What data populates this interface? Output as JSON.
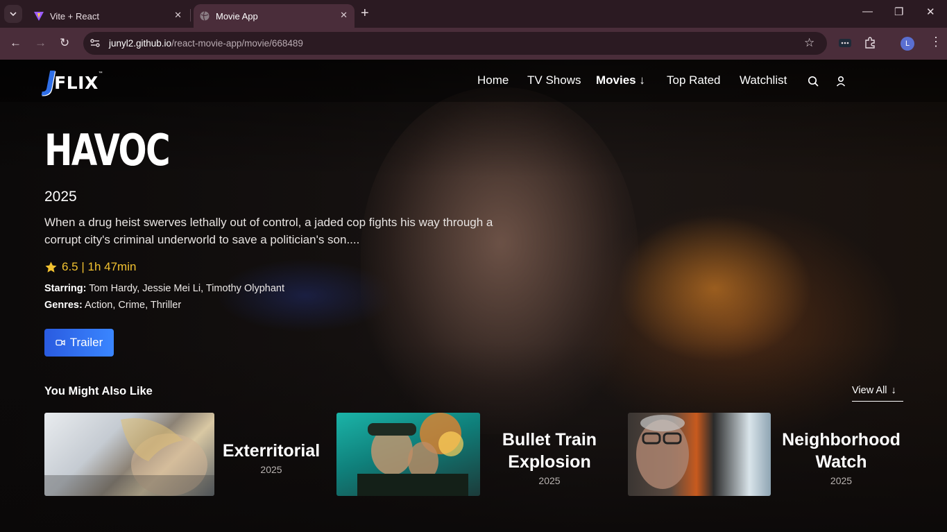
{
  "browser": {
    "tabs": [
      {
        "title": "Vite + React",
        "icon": "vite-icon",
        "active": false
      },
      {
        "title": "Movie App",
        "icon": "globe-icon",
        "active": true
      }
    ],
    "url_host": "junyl2.github.io",
    "url_path": "/react-movie-app/movie/668489",
    "profile_initial": "L"
  },
  "site": {
    "logo_letter": "J",
    "logo_text": "FLIX",
    "logo_tm": "™",
    "nav": [
      {
        "label": "Home"
      },
      {
        "label": "TV Shows"
      },
      {
        "label": "Movies ↓",
        "active": true
      },
      {
        "label": "Top Rated"
      },
      {
        "label": "Watchlist"
      }
    ]
  },
  "movie": {
    "title": "HAVOC",
    "year": "2025",
    "overview": "When a drug heist swerves lethally out of control, a jaded cop fights his way through a corrupt city's criminal underworld to save a politician's son....",
    "rating_text": "6.5 | 1h 47min",
    "starring_label": "Starring:",
    "starring": "Tom Hardy, Jessie Mei Li, Timothy Olyphant",
    "genres_label": "Genres:",
    "genres": "Action, Crime, Thriller",
    "trailer_label": "Trailer"
  },
  "recommendations": {
    "heading": "You Might Also Like",
    "view_all": "View All",
    "items": [
      {
        "title": "Exterritorial",
        "year": "2025"
      },
      {
        "title": "Bullet Train Explosion",
        "year": "2025"
      },
      {
        "title": "Neighborhood Watch",
        "year": "2025"
      }
    ]
  },
  "colors": {
    "accent": "#3a86ff",
    "rating": "#f2c230",
    "browser_frame": "#4a2d3a"
  }
}
